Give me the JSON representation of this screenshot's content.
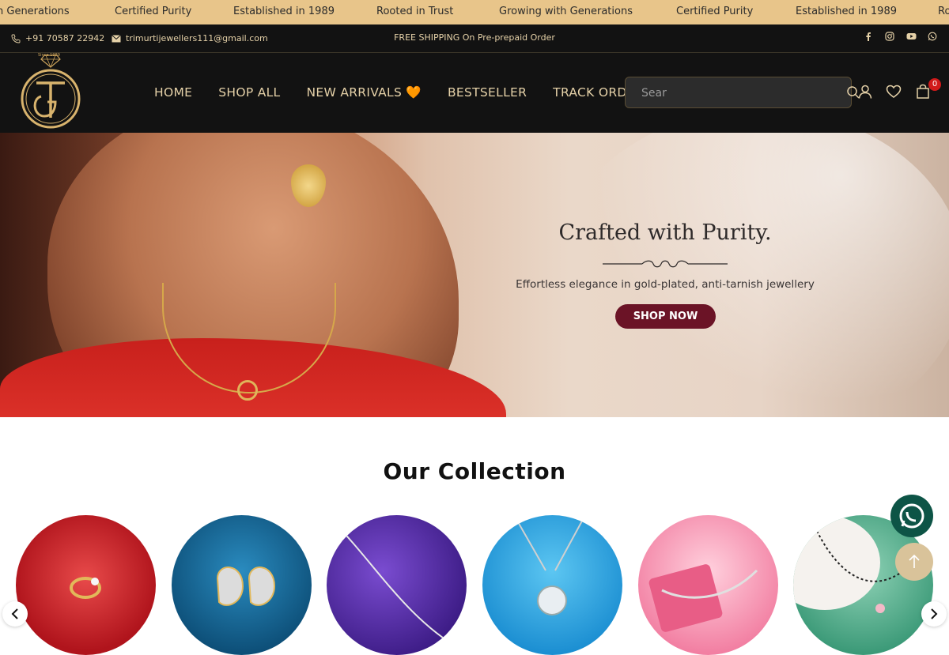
{
  "marquee": {
    "items": [
      "n Generations",
      "Certified Purity",
      "Established in 1989",
      "Rooted in Trust",
      "Growing with Generations",
      "Certified Purity",
      "Established in 1989",
      "Ro"
    ]
  },
  "contact": {
    "phone": "+91 70587 22942",
    "email": "trimurtijewellers111@gmail.com",
    "shipping": "FREE SHIPPING On Pre-prepaid Order"
  },
  "social": {
    "icons": [
      "facebook-icon",
      "instagram-icon",
      "youtube-icon",
      "whatsapp-icon"
    ]
  },
  "header": {
    "logo_tagline": "Since 1989",
    "logo_letters": "TJ",
    "nav": [
      "HOME",
      "SHOP ALL",
      "NEW ARRIVALS 🧡",
      "BESTSELLER",
      "TRACK ORDER"
    ],
    "search": {
      "value": "Sear",
      "placeholder": "Sear"
    },
    "cart_count": "0"
  },
  "hero": {
    "title": "Crafted with Purity.",
    "subtitle": "Effortless elegance in gold-plated, anti-tarnish jewellery",
    "cta": "SHOP NOW"
  },
  "collection": {
    "title": "Our Collection",
    "items": [
      {
        "name": "ring",
        "bg": "#c21d26"
      },
      {
        "name": "earrings",
        "bg": "#1a6f9c"
      },
      {
        "name": "chain",
        "bg": "#5a2ea6"
      },
      {
        "name": "pendant",
        "bg": "#2aa8e6"
      },
      {
        "name": "bracelet",
        "bg": "#f5a6c0"
      },
      {
        "name": "mangalsutra",
        "bg": "#4ea88a"
      }
    ]
  },
  "colors": {
    "accent": "#e8c58a",
    "header_bg": "#121212",
    "cta": "#6b1326",
    "whatsapp": "#0d5446"
  }
}
